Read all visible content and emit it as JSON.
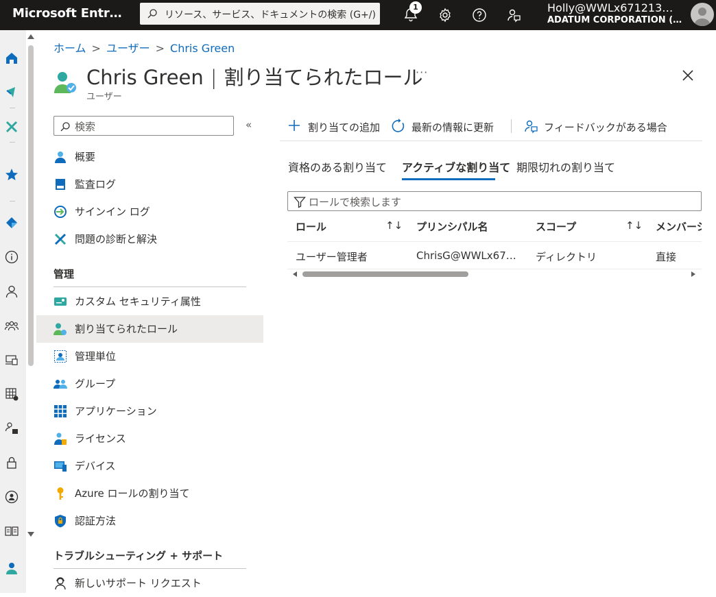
{
  "topbar": {
    "brand": "Microsoft Entr…",
    "search_placeholder": "リソース、サービス、ドキュメントの検索 (G+/)",
    "notification_count": "1",
    "account_email": "Holly@WWLx671213…",
    "account_org": "ADATUM CORPORATION (…"
  },
  "breadcrumb": [
    "ホーム",
    "ユーザー",
    "Chris Green"
  ],
  "header": {
    "name": "Chris Green",
    "separator": "|",
    "page": "割り当てられたロール",
    "subtitle": "ユーザー",
    "more": "···"
  },
  "menu": {
    "search_placeholder": "検索",
    "collapse": "«",
    "items_top": [
      {
        "label": "概要",
        "icon": "user-icon"
      },
      {
        "label": "監査ログ",
        "icon": "audit-log-icon"
      },
      {
        "label": "サインイン ログ",
        "icon": "sign-in-log-icon"
      },
      {
        "label": "問題の診断と解決",
        "icon": "tools-icon"
      }
    ],
    "section_manage": "管理",
    "items_manage": [
      {
        "label": "カスタム セキュリティ属性",
        "icon": "custom-attribute-icon"
      },
      {
        "label": "割り当てられたロール",
        "icon": "assigned-roles-icon",
        "selected": true
      },
      {
        "label": "管理単位",
        "icon": "admin-unit-icon"
      },
      {
        "label": "グループ",
        "icon": "groups-icon"
      },
      {
        "label": "アプリケーション",
        "icon": "applications-icon"
      },
      {
        "label": "ライセンス",
        "icon": "licenses-icon"
      },
      {
        "label": "デバイス",
        "icon": "devices-icon"
      },
      {
        "label": "Azure ロールの割り当て",
        "icon": "key-icon"
      },
      {
        "label": "認証方法",
        "icon": "shield-icon"
      }
    ],
    "section_support": "トラブルシューティング + サポート",
    "items_support": [
      {
        "label": "新しいサポート リクエスト",
        "icon": "support-icon"
      }
    ]
  },
  "commands": {
    "add": "割り当ての追加",
    "refresh": "最新の情報に更新",
    "feedback": "フィードバックがある場合"
  },
  "tabs": [
    "資格のある割り当て",
    "アクティブな割り当て",
    "期限切れの割り当て"
  ],
  "active_tab": 1,
  "filter_placeholder": "ロールで検索します",
  "table": {
    "columns": [
      "ロール",
      "プリンシパル名",
      "スコープ",
      "メンバーシップ"
    ],
    "rows": [
      [
        "ユーザー管理者",
        "ChrisG@WWLx67…",
        "ディレクトリ",
        "直接"
      ]
    ]
  },
  "colors": {
    "topbar": "#1b1a19",
    "accent": "#0f6cbd",
    "selected": "#edebe9"
  }
}
